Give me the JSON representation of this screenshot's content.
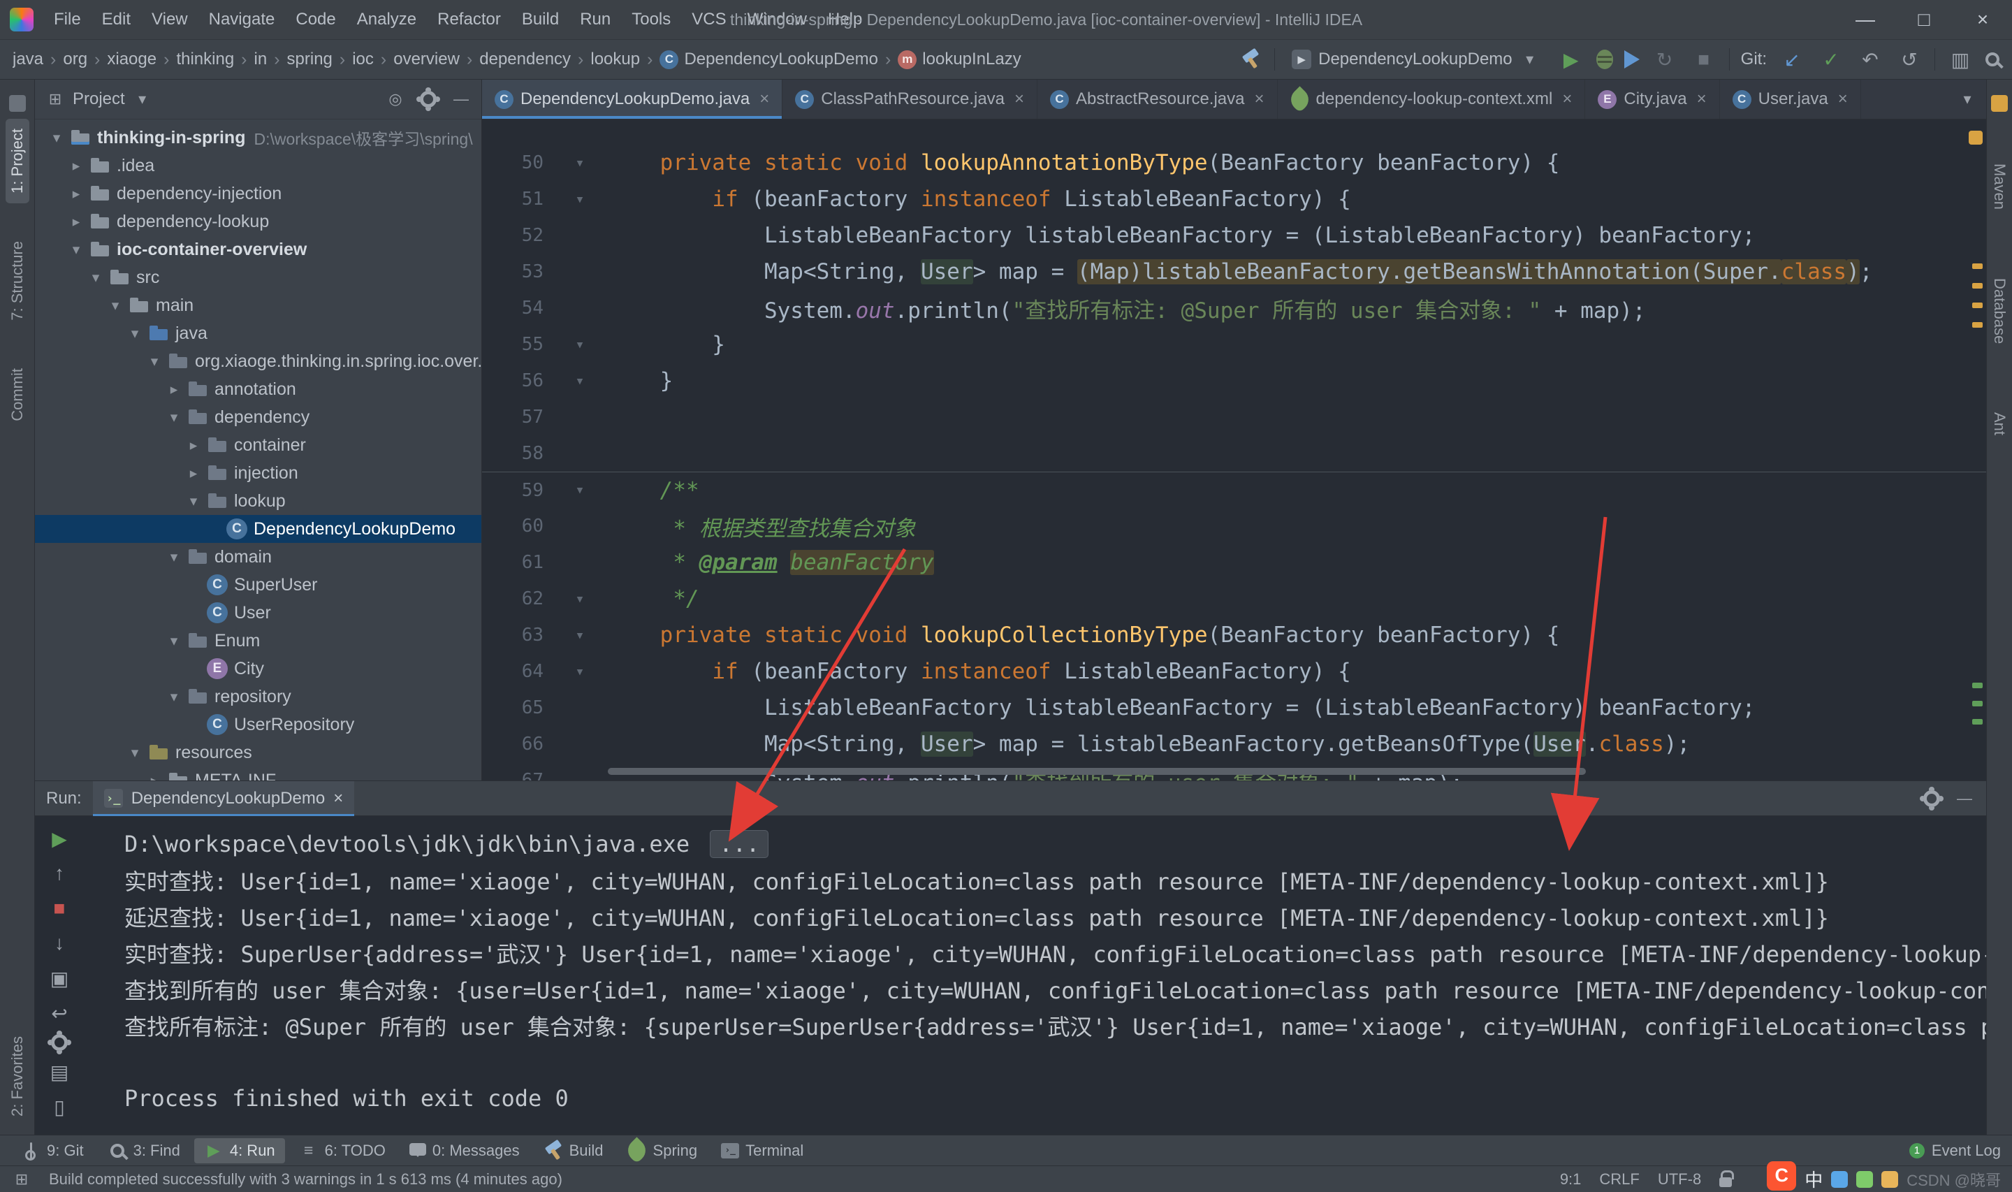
{
  "colors": {
    "accent_blue": "#4a88c7",
    "run_green": "#499c54",
    "error_red": "#c75450",
    "warning_yellow": "#d9a343",
    "arrow_red": "#e23c35",
    "selection_blue": "#0d3a63"
  },
  "title_bar": {
    "menu": [
      "File",
      "Edit",
      "View",
      "Navigate",
      "Code",
      "Analyze",
      "Refactor",
      "Build",
      "Run",
      "Tools",
      "VCS",
      "Window",
      "Help"
    ],
    "title": "thinking-in-spring - DependencyLookupDemo.java [ioc-container-overview] - IntelliJ IDEA"
  },
  "toolbar": {
    "breadcrumbs": [
      {
        "label": "java"
      },
      {
        "label": "org"
      },
      {
        "label": "xiaoge"
      },
      {
        "label": "thinking"
      },
      {
        "label": "in"
      },
      {
        "label": "spring"
      },
      {
        "label": "ioc"
      },
      {
        "label": "overview"
      },
      {
        "label": "dependency"
      },
      {
        "label": "lookup"
      },
      {
        "label": "DependencyLookupDemo",
        "icon": "class"
      },
      {
        "label": "lookupInLazy",
        "icon": "method"
      }
    ],
    "run_config": "DependencyLookupDemo",
    "git_label": "Git:"
  },
  "left_stripe": {
    "top": [
      "1: Project",
      "7: Structure",
      "Commit"
    ],
    "bottom": [
      "2: Favorites"
    ]
  },
  "right_stripe": {
    "labels": [
      "Maven",
      "Database",
      "Ant"
    ]
  },
  "project_panel": {
    "title": "Project",
    "tree": [
      {
        "depth": 0,
        "arrow": "open",
        "icon": "module",
        "label": "thinking-in-spring",
        "suffix": "D:\\workspace\\极客学习\\spring\\",
        "bold": true
      },
      {
        "depth": 1,
        "arrow": "closed",
        "icon": "folder",
        "label": ".idea"
      },
      {
        "depth": 1,
        "arrow": "closed",
        "icon": "folder",
        "label": "dependency-injection"
      },
      {
        "depth": 1,
        "arrow": "closed",
        "icon": "folder",
        "label": "dependency-lookup"
      },
      {
        "depth": 1,
        "arrow": "open",
        "icon": "folder",
        "label": "ioc-container-overview",
        "bold": true
      },
      {
        "depth": 2,
        "arrow": "open",
        "icon": "folder",
        "label": "src"
      },
      {
        "depth": 3,
        "arrow": "open",
        "icon": "folder",
        "label": "main"
      },
      {
        "depth": 4,
        "arrow": "open",
        "icon": "folder-src",
        "label": "java"
      },
      {
        "depth": 5,
        "arrow": "open",
        "icon": "package",
        "label": "org.xiaoge.thinking.in.spring.ioc.over..."
      },
      {
        "depth": 6,
        "arrow": "closed",
        "icon": "package",
        "label": "annotation"
      },
      {
        "depth": 6,
        "arrow": "open",
        "icon": "package",
        "label": "dependency"
      },
      {
        "depth": 7,
        "arrow": "closed",
        "icon": "package",
        "label": "container"
      },
      {
        "depth": 7,
        "arrow": "closed",
        "icon": "package",
        "label": "injection"
      },
      {
        "depth": 7,
        "arrow": "open",
        "icon": "package",
        "label": "lookup"
      },
      {
        "depth": 8,
        "icon": "class",
        "label": "DependencyLookupDemo",
        "selected": true
      },
      {
        "depth": 6,
        "arrow": "open",
        "icon": "package",
        "label": "domain"
      },
      {
        "depth": 7,
        "icon": "class",
        "label": "SuperUser"
      },
      {
        "depth": 7,
        "icon": "class",
        "label": "User"
      },
      {
        "depth": 6,
        "arrow": "open",
        "icon": "package",
        "label": "Enum"
      },
      {
        "depth": 7,
        "icon": "enum",
        "label": "City"
      },
      {
        "depth": 6,
        "arrow": "open",
        "icon": "package",
        "label": "repository"
      },
      {
        "depth": 7,
        "icon": "class",
        "label": "UserRepository"
      },
      {
        "depth": 4,
        "arrow": "open",
        "icon": "folder-res",
        "label": "resources"
      },
      {
        "depth": 5,
        "arrow": "closed",
        "icon": "folder",
        "label": "META-INF"
      }
    ]
  },
  "editor": {
    "tabs": [
      {
        "icon": "class",
        "label": "DependencyLookupDemo.java",
        "active": true
      },
      {
        "icon": "class",
        "label": "ClassPathResource.java"
      },
      {
        "icon": "class",
        "label": "AbstractResource.java"
      },
      {
        "icon": "spring",
        "label": "dependency-lookup-context.xml"
      },
      {
        "icon": "enum",
        "label": "City.java"
      },
      {
        "icon": "class",
        "label": "User.java"
      }
    ],
    "lines": [
      {
        "n": 50,
        "fold": true,
        "seg": [
          {
            "t": "    "
          },
          {
            "t": "private static void ",
            "c": "k"
          },
          {
            "t": "lookupAnnotationByType",
            "c": "m"
          },
          {
            "t": "(BeanFactory beanFactory) {"
          }
        ]
      },
      {
        "n": 51,
        "fold": true,
        "seg": [
          {
            "t": "        "
          },
          {
            "t": "if",
            "c": "k"
          },
          {
            "t": " (beanFactory "
          },
          {
            "t": "instanceof",
            "c": "k"
          },
          {
            "t": " ListableBeanFactory) {"
          }
        ]
      },
      {
        "n": 52,
        "seg": [
          {
            "t": "            ListableBeanFactory listableBeanFactory = (ListableBeanFactory) beanFactory;"
          }
        ]
      },
      {
        "n": 53,
        "seg": [
          {
            "t": "            Map<String, "
          },
          {
            "t": "User",
            "b": "g"
          },
          {
            "t": "> map = "
          },
          {
            "t": "(Map)listableBeanFactory.getBeansWithAnnotation(Super.",
            "b": "w"
          },
          {
            "t": "class",
            "c": "k",
            "b": "w"
          },
          {
            "t": ")",
            "b": "w"
          },
          {
            "t": ";"
          }
        ]
      },
      {
        "n": 54,
        "seg": [
          {
            "t": "            System."
          },
          {
            "t": "out",
            "c": "f"
          },
          {
            "t": ".println("
          },
          {
            "t": "\"查找所有标注: @Super 所有的 user 集合对象: \"",
            "c": "s"
          },
          {
            "t": " + map);"
          }
        ]
      },
      {
        "n": 55,
        "fold": true,
        "seg": [
          {
            "t": "        }"
          }
        ]
      },
      {
        "n": 56,
        "fold": true,
        "seg": [
          {
            "t": "    }"
          }
        ]
      },
      {
        "n": 57,
        "seg": []
      },
      {
        "n": 58,
        "seg": []
      },
      {
        "n": 59,
        "fold": true,
        "sep": true,
        "seg": [
          {
            "t": "    "
          },
          {
            "t": "/**",
            "c": "c"
          }
        ]
      },
      {
        "n": 60,
        "seg": [
          {
            "t": "     * 根据类型查找集合对象",
            "c": "c"
          }
        ]
      },
      {
        "n": 61,
        "seg": [
          {
            "t": "     * ",
            "c": "c"
          },
          {
            "t": "@param",
            "c": "ct"
          },
          {
            "t": " ",
            "c": "c"
          },
          {
            "t": "beanFactory",
            "c": "c",
            "b": "w"
          }
        ]
      },
      {
        "n": 62,
        "fold": true,
        "seg": [
          {
            "t": "     */",
            "c": "c"
          }
        ]
      },
      {
        "n": 63,
        "fold": true,
        "seg": [
          {
            "t": "    "
          },
          {
            "t": "private static void ",
            "c": "k"
          },
          {
            "t": "lookupCollectionByType",
            "c": "m"
          },
          {
            "t": "(BeanFactory beanFactory) {"
          }
        ]
      },
      {
        "n": 64,
        "fold": true,
        "seg": [
          {
            "t": "        "
          },
          {
            "t": "if",
            "c": "k"
          },
          {
            "t": " (beanFactory "
          },
          {
            "t": "instanceof",
            "c": "k"
          },
          {
            "t": " ListableBeanFactory) {"
          }
        ]
      },
      {
        "n": 65,
        "seg": [
          {
            "t": "            ListableBeanFactory listableBeanFactory = (ListableBeanFactory) beanFactory;"
          }
        ]
      },
      {
        "n": 66,
        "seg": [
          {
            "t": "            Map<String, "
          },
          {
            "t": "User",
            "b": "g"
          },
          {
            "t": "> map = listableBeanFactory.getBeansOfType("
          },
          {
            "t": "User",
            "b": "g"
          },
          {
            "t": "."
          },
          {
            "t": "class",
            "c": "k"
          },
          {
            "t": ");"
          }
        ]
      },
      {
        "n": 67,
        "seg": [
          {
            "t": "            System."
          },
          {
            "t": "out",
            "c": "f"
          },
          {
            "t": ".println("
          },
          {
            "t": "\"查找到所有的 user 集合对象: \"",
            "c": "s"
          },
          {
            "t": " + map);"
          }
        ]
      }
    ]
  },
  "run_panel": {
    "label": "Run:",
    "tab": {
      "label": "DependencyLookupDemo"
    },
    "lines": [
      {
        "t": "D:\\workspace\\devtools\\jdk\\jdk\\bin\\java.exe ",
        "ellipsis": true
      },
      {
        "t": "实时查找: User{id=1, name='xiaoge', city=WUHAN, configFileLocation=class path resource [META-INF/dependency-lookup-context.xml]}"
      },
      {
        "t": "延迟查找: User{id=1, name='xiaoge', city=WUHAN, configFileLocation=class path resource [META-INF/dependency-lookup-context.xml]}"
      },
      {
        "t": "实时查找: SuperUser{address='武汉'} User{id=1, name='xiaoge', city=WUHAN, configFileLocation=class path resource [META-INF/dependency-lookup-c"
      },
      {
        "t": "查找到所有的 user 集合对象: {user=User{id=1, name='xiaoge', city=WUHAN, configFileLocation=class path resource [META-INF/dependency-lookup-cont"
      },
      {
        "t": "查找所有标注: @Super 所有的 user 集合对象: {superUser=SuperUser{address='武汉'} User{id=1, name='xiaoge', city=WUHAN, configFileLocation=class pa"
      },
      {
        "t": ""
      },
      {
        "t": "Process finished with exit code 0"
      }
    ]
  },
  "bottom_bar": {
    "items": [
      {
        "icon": "git-sm",
        "label": "9: Git"
      },
      {
        "icon": "search-sm",
        "label": "3: Find"
      },
      {
        "icon": "run-sm",
        "label": "4: Run",
        "active": true
      },
      {
        "icon": "todo-sm",
        "label": "6: TODO"
      },
      {
        "icon": "msg-sm",
        "label": "0: Messages"
      },
      {
        "icon": "build-sm",
        "label": "Build"
      },
      {
        "icon": "spring-sm",
        "label": "Spring"
      },
      {
        "icon": "term-sm",
        "label": "Terminal"
      }
    ],
    "event_log": {
      "badge": "1",
      "label": "Event Log"
    }
  },
  "status_bar": {
    "message": "Build completed successfully with 3 warnings in 1 s 613 ms (4 minutes ago)",
    "caret": "9:1",
    "line_separator": "CRLF",
    "encoding": "UTF-8",
    "watermark": {
      "ime": "中",
      "text": "CSDN @晓哥"
    }
  }
}
